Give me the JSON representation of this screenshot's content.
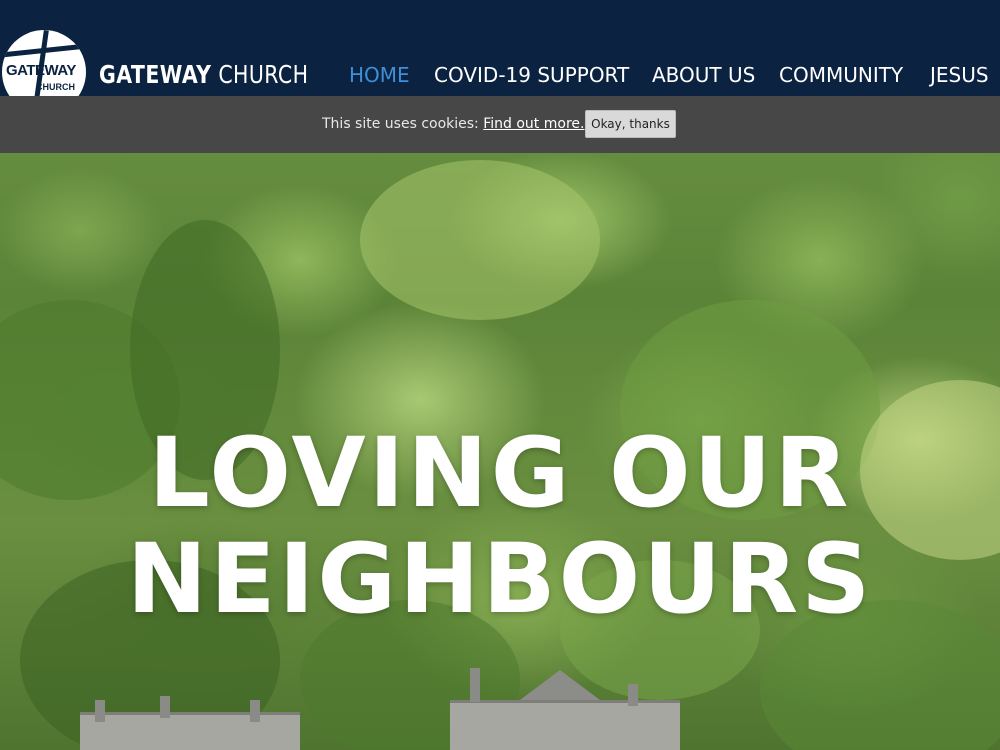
{
  "header": {
    "logo_text_main": "GATEWAY",
    "logo_text_sub": "CHURCH",
    "site_name_bold": "GATEWAY",
    "site_name_light": "CHURCH",
    "nav": [
      {
        "label": "HOME",
        "active": true
      },
      {
        "label": "COVID-19 SUPPORT",
        "active": false
      },
      {
        "label": "ABOUT US",
        "active": false
      },
      {
        "label": "COMMUNITY",
        "active": false
      },
      {
        "label": "JESUS",
        "active": false
      }
    ]
  },
  "cookie_bar": {
    "message": "This site uses cookies:",
    "link_label": "Find out more.",
    "button_label": "Okay, thanks"
  },
  "hero": {
    "title_line1": "LOVING OUR",
    "title_line2": "NEIGHBOURS"
  },
  "colors": {
    "header_bg": "#0b2340",
    "nav_active": "#3f8fd8",
    "cookie_bg": "#474747"
  }
}
